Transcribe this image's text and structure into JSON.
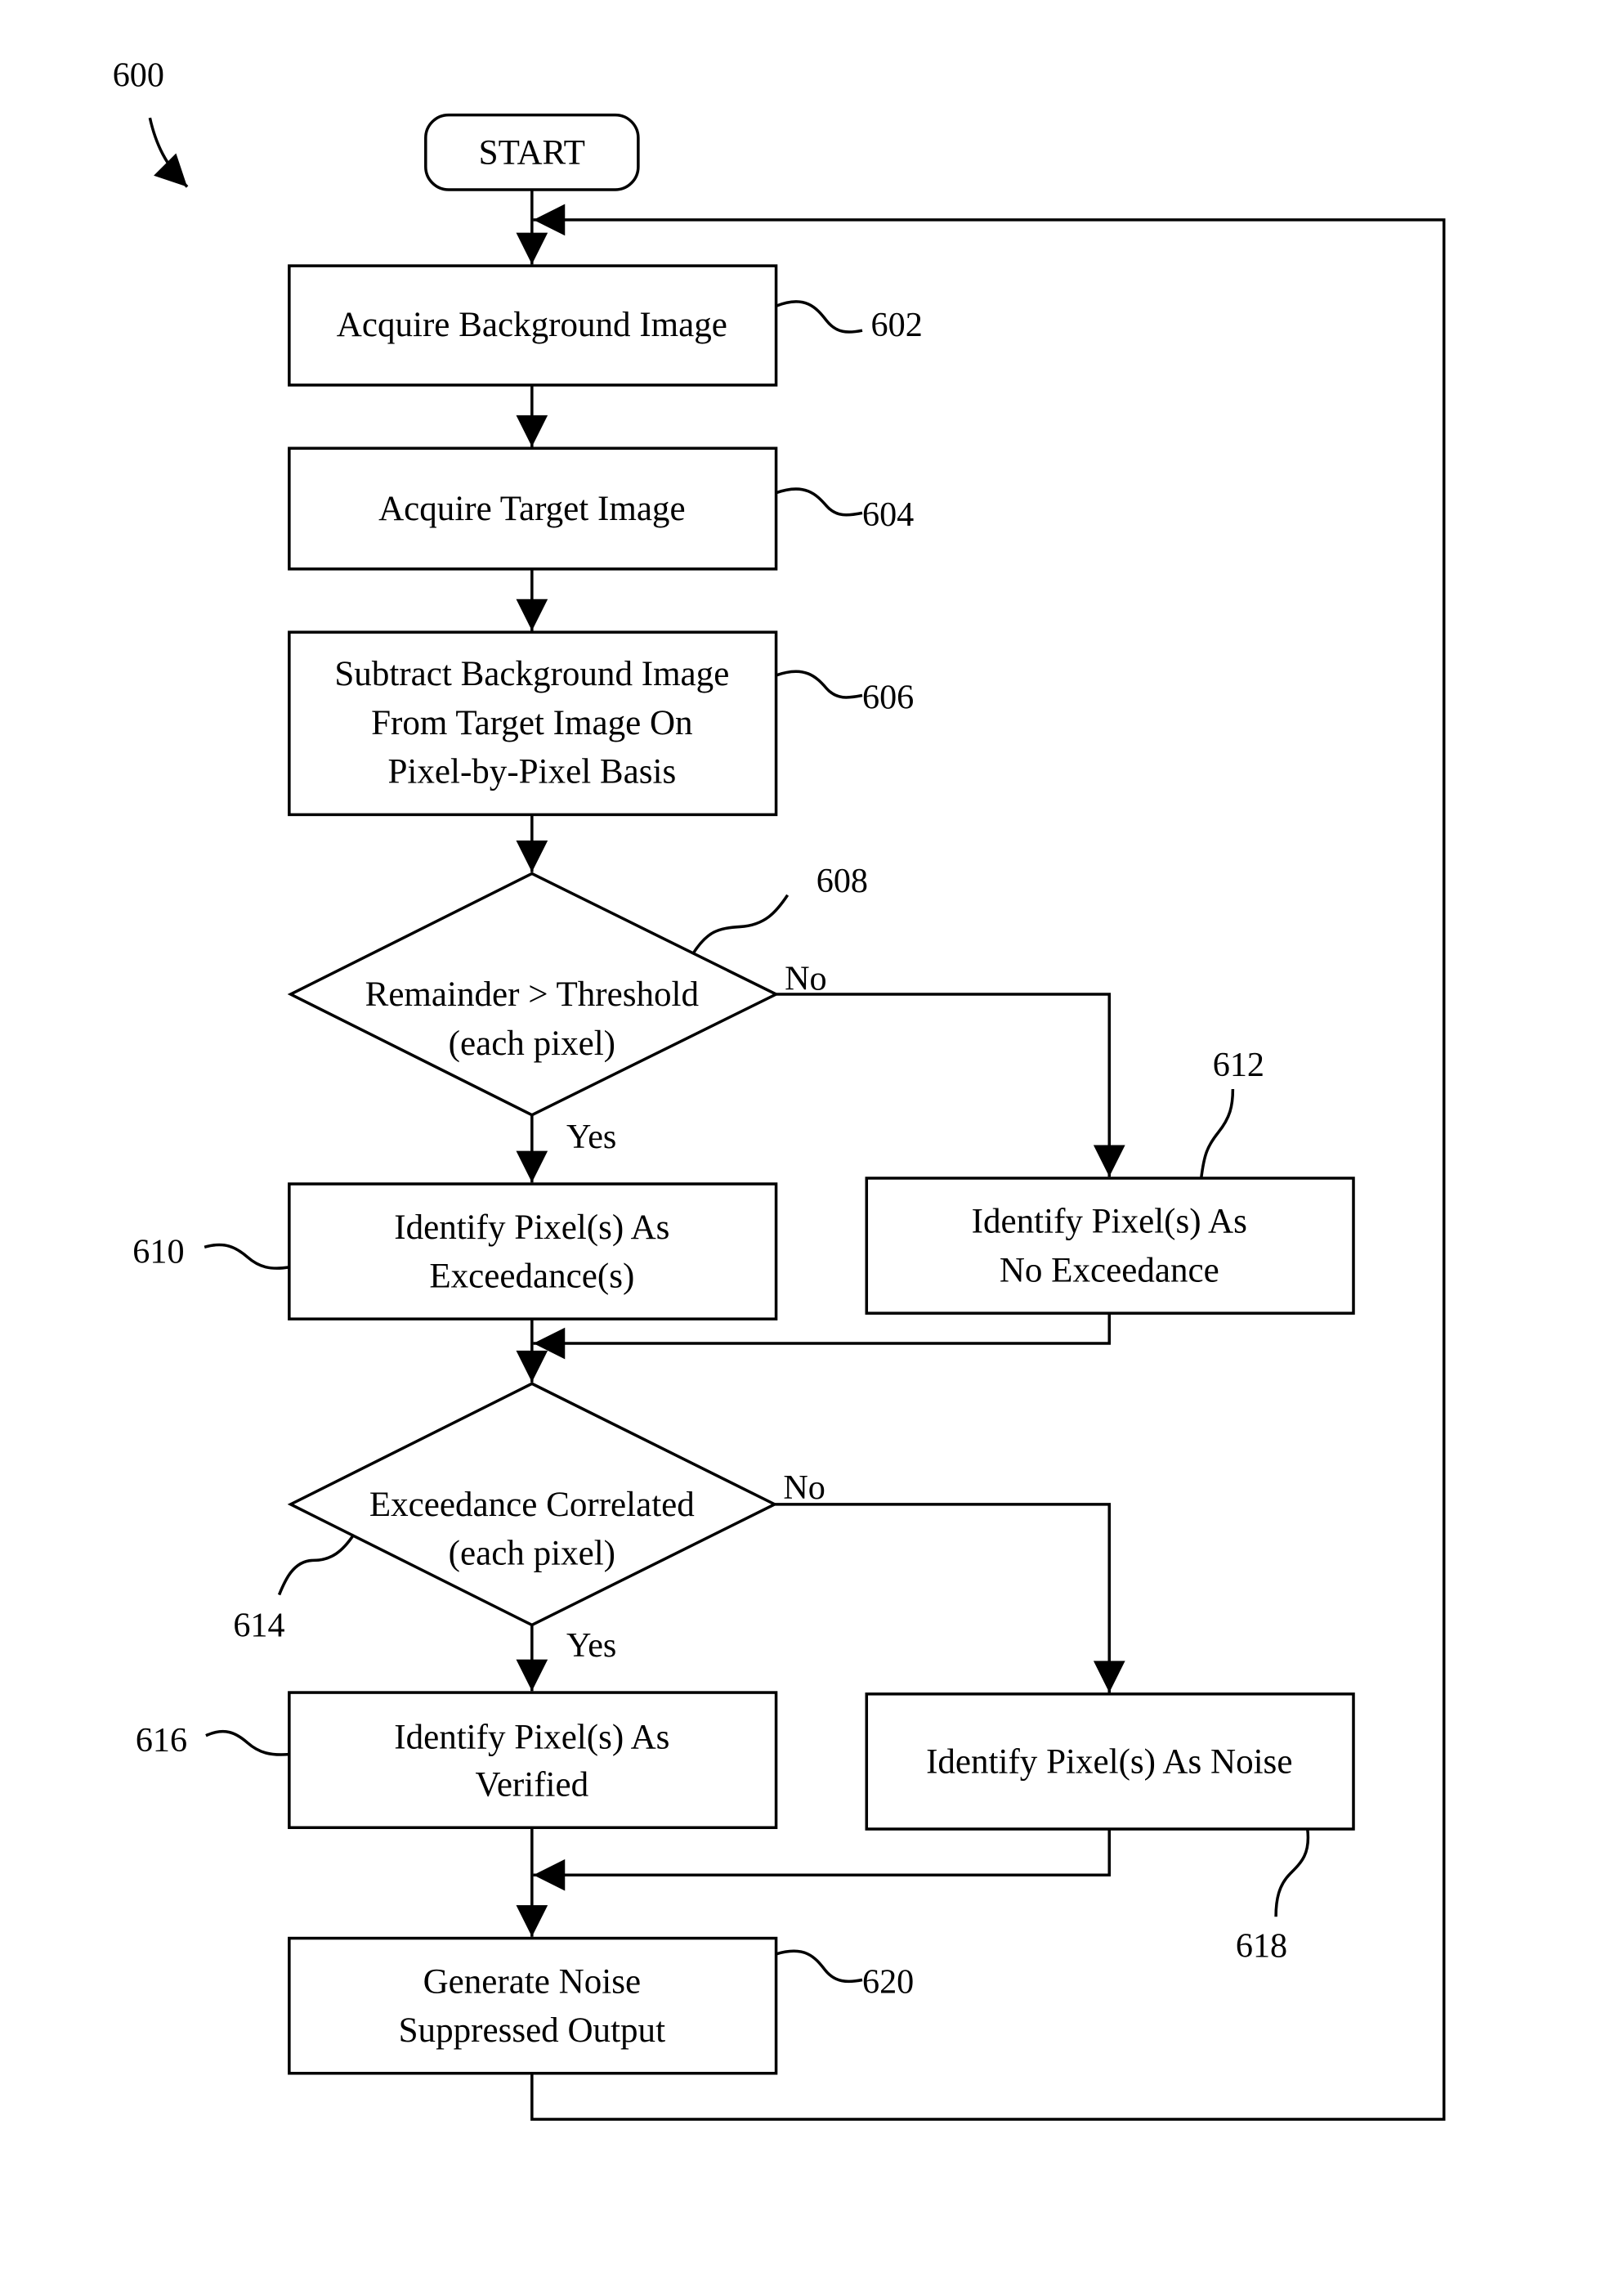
{
  "figure": {
    "ref": "600"
  },
  "nodes": {
    "start": {
      "label": "START"
    },
    "n602": {
      "ref": "602",
      "lines": [
        "Acquire Background Image"
      ]
    },
    "n604": {
      "ref": "604",
      "lines": [
        "Acquire Target Image"
      ]
    },
    "n606": {
      "ref": "606",
      "lines": [
        "Subtract Background Image",
        "From Target Image On",
        "Pixel-by-Pixel Basis"
      ]
    },
    "n608": {
      "ref": "608",
      "lines": [
        "Remainder > Threshold",
        "(each pixel)"
      ]
    },
    "n610": {
      "ref": "610",
      "lines": [
        "Identify Pixel(s) As",
        "Exceedance(s)"
      ]
    },
    "n612": {
      "ref": "612",
      "lines": [
        "Identify Pixel(s) As",
        "No Exceedance"
      ]
    },
    "n614": {
      "ref": "614",
      "lines": [
        "Exceedance Correlated",
        "(each pixel)"
      ]
    },
    "n616": {
      "ref": "616",
      "lines": [
        "Identify Pixel(s) As",
        "Verified"
      ]
    },
    "n618": {
      "ref": "618",
      "lines": [
        "Identify Pixel(s) As Noise"
      ]
    },
    "n620": {
      "ref": "620",
      "lines": [
        "Generate Noise",
        "Suppressed Output"
      ]
    }
  },
  "edges": {
    "d608_yes": "Yes",
    "d608_no": "No",
    "d614_yes": "Yes",
    "d614_no": "No"
  }
}
